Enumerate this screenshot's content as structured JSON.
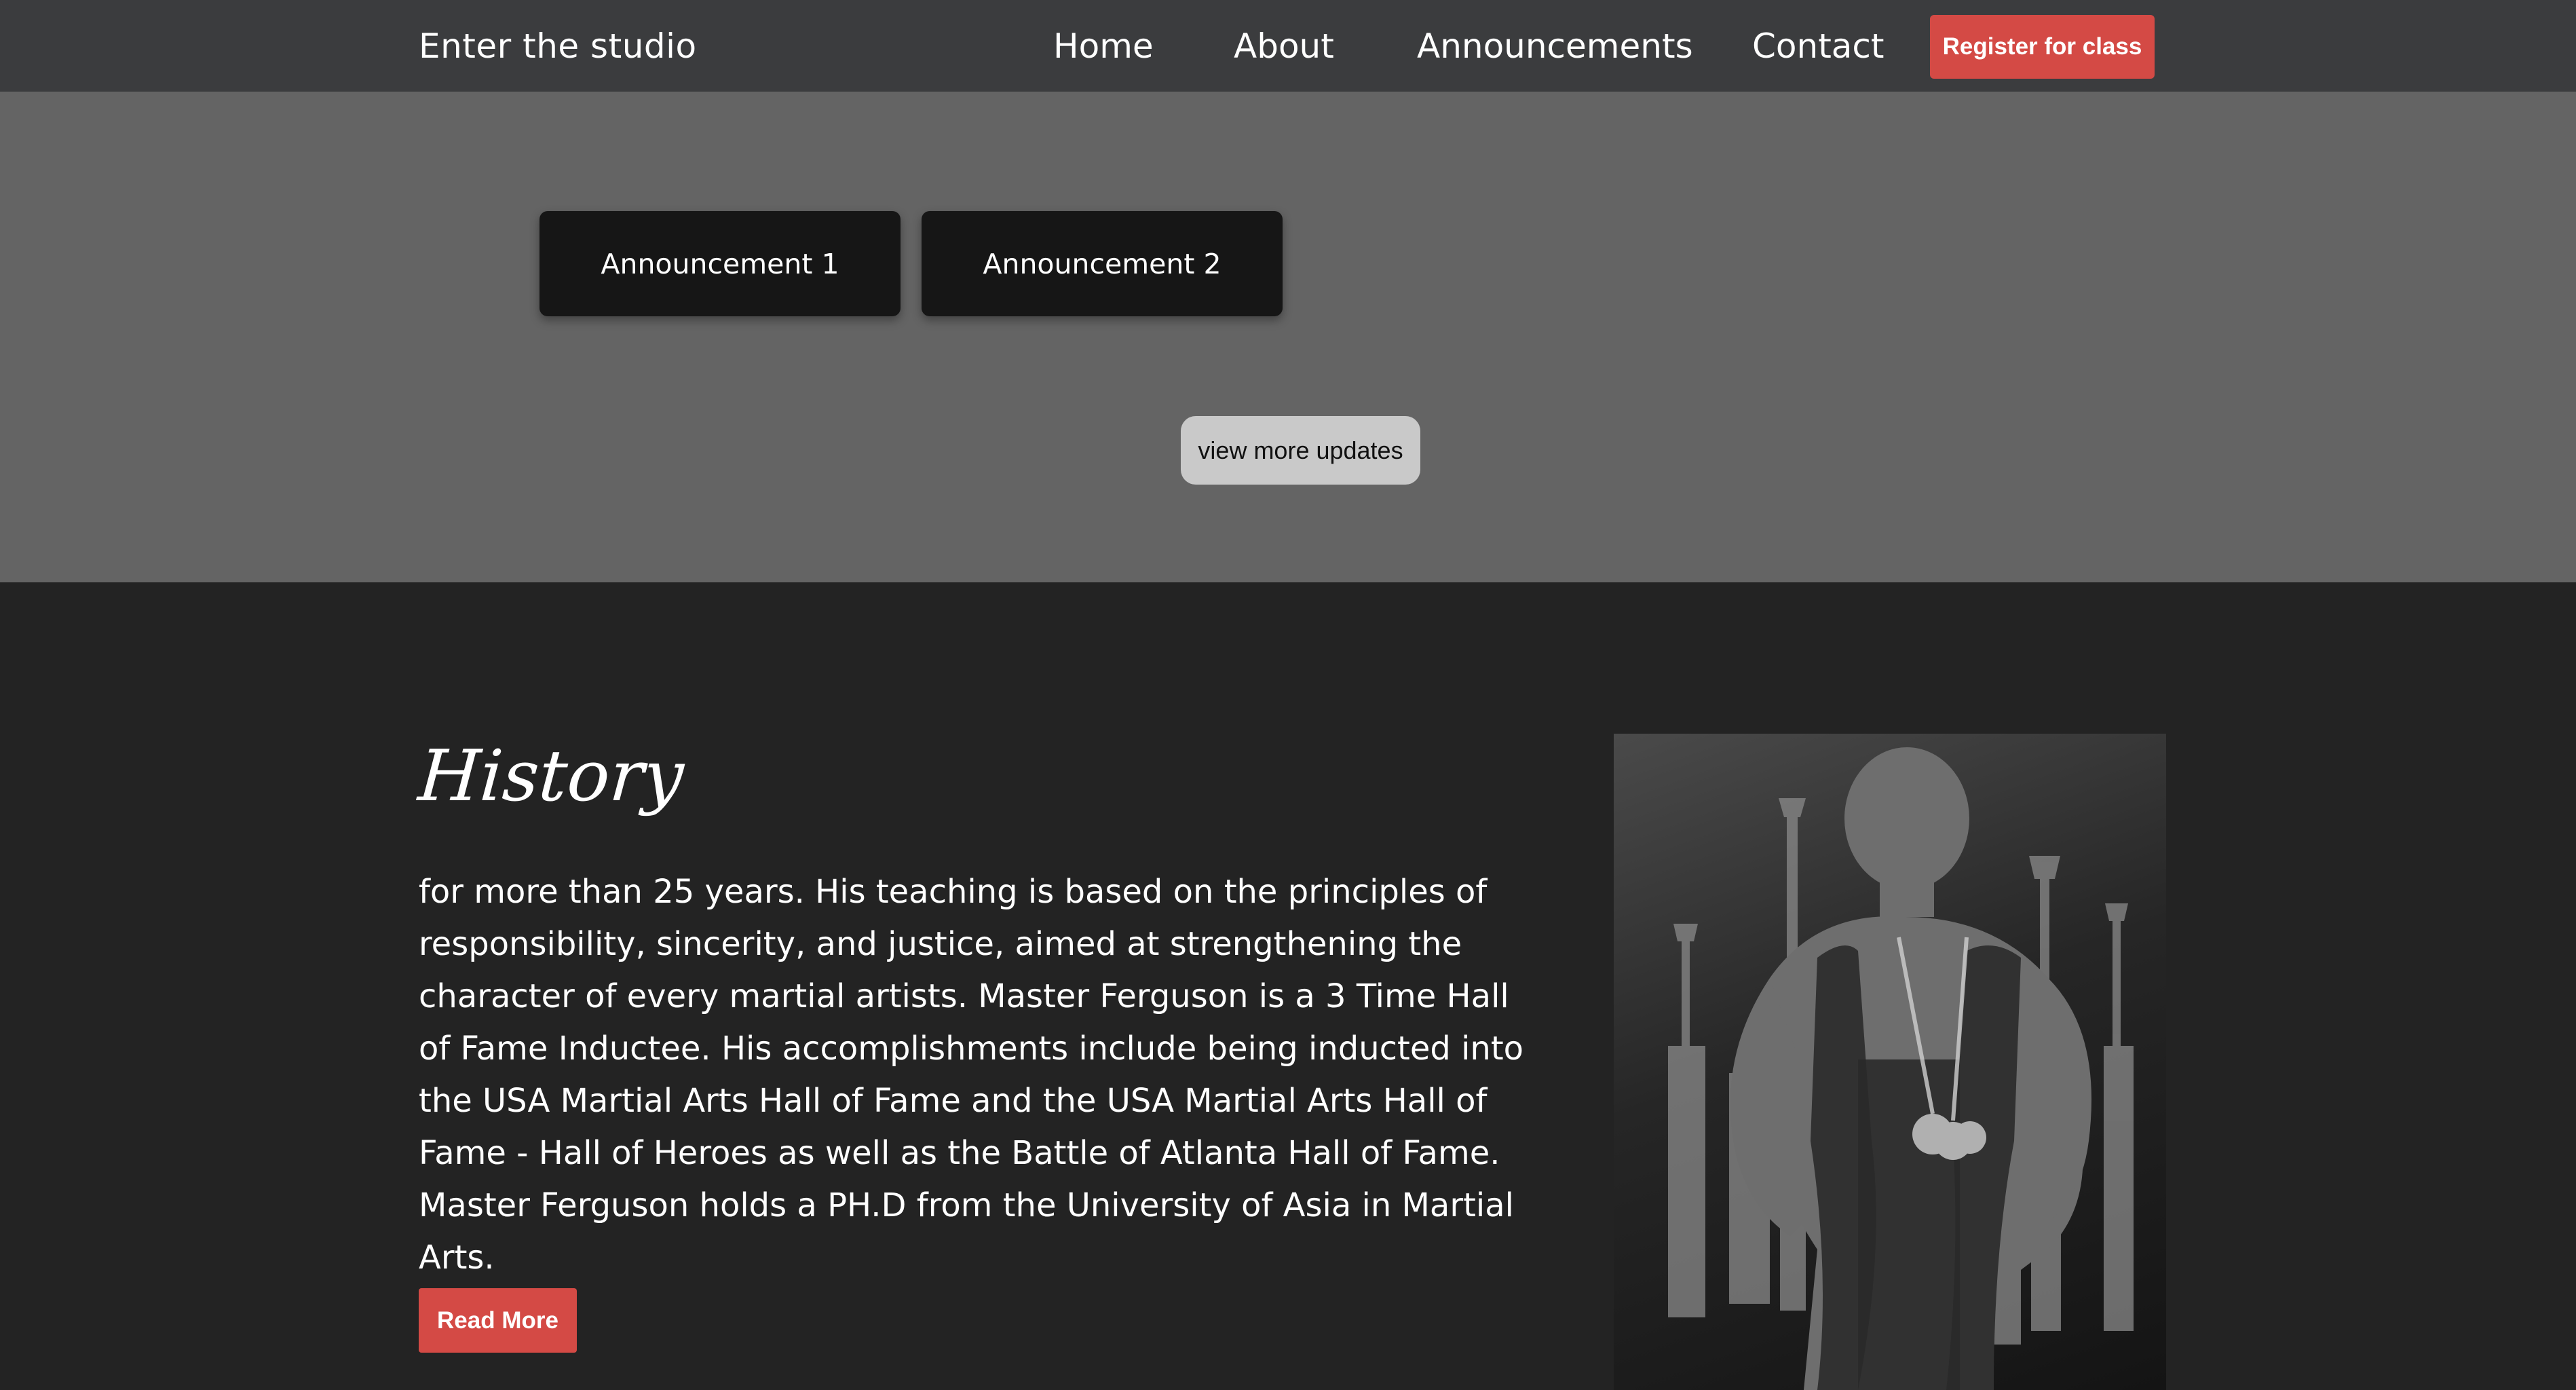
{
  "colors": {
    "accent": "#d44a45",
    "nav_bg": "#3b3c3e",
    "announce_bg": "#646464",
    "history_bg": "#232323"
  },
  "nav": {
    "brand": "Enter the studio",
    "links": [
      "Home",
      "About",
      "Announcements",
      "Contact"
    ],
    "register_label": "Register for class"
  },
  "announcements": {
    "cards": [
      "Announcement 1",
      "Announcement 2"
    ],
    "more_label": "view more updates"
  },
  "history": {
    "title": "History",
    "body": "for more than 25 years. His teaching is based on the principles of responsibility, sincerity, and justice, aimed at strengthening the character of every martial artists. Master Ferguson is a 3 Time Hall of Fame Inductee. His accomplishments include being inducted into the USA Martial Arts Hall of Fame and the USA Martial Arts Hall of Fame - Hall of Heroes as well as the Battle of Atlanta Hall of Fame. Master Ferguson holds a PH.D from the University of Asia in Martial Arts.",
    "read_more_label": "Read More",
    "photo_icon": "portrait-photo-icon"
  }
}
